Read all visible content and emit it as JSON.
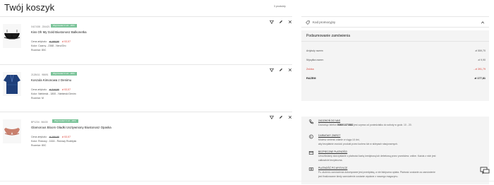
{
  "page": {
    "title": "Twój koszyk",
    "count": "3 produkty"
  },
  "items": [
    {
      "sku": "0417438 . 234421",
      "badge": "Wyprzedaż 3 szt. -30%",
      "name": "Kiss Oh My Gold Biustonosz Balkonetka",
      "price_label": "Cena artykułu:",
      "old_price": "zł 169,99",
      "new_price": "zł 53,57",
      "color": "Kolor: Czarny - 2368 - Nero/Oro",
      "size": "Rozmiar: 80C"
    },
    {
      "sku": "2128411 . 98691",
      "badge": "Wyprzedaż 3 szt. -30%",
      "name": "Koszula Kimonowa z Denimu",
      "price_label": "Cena artykułu:",
      "old_price": "zł 219,99",
      "new_price": "zł 53,57",
      "color": "Kolor: Niebieski - 1800 - Niebieski Denim",
      "size": "Rozmiar: M"
    },
    {
      "sku": "BP1234 . 56430",
      "badge": "Wyprzedaż 3 szt. -30%",
      "name": "Glamorous Bloom Gładki Usztywniony Biustonosz Opaska",
      "price_label": "Cena artykułu:",
      "old_price": "zł 169,99",
      "new_price": "zł 53,57",
      "color": "Kolor: Różowy - 1616 - Różowy Rozbłysk",
      "size": "Rozmiar: 80C"
    }
  ],
  "promo": {
    "label": "Kod promocyjny"
  },
  "summary": {
    "title": "Podsumowanie zamówienia",
    "rows": [
      {
        "label": "Artykuły razem",
        "value": "zł 559,70"
      },
      {
        "label": "Wysyłka razem",
        "value": "zł 9,90"
      },
      {
        "label": "Zniżka",
        "value": "- zł 391,79"
      },
      {
        "label": "RAZEM",
        "value": "zł 177,81"
      }
    ]
  },
  "info": [
    {
      "icon": "phone-icon",
      "heading": "ZADZWOŃ DO NAS",
      "text": "Dzwoniąc telefon ",
      "phone": "008001373882",
      "text2": " jest czynna od poniedziałku do soboty w godz. 10 - 20."
    },
    {
      "icon": "return-icon",
      "heading": "DARMOWY ZWROT",
      "text": "Możesz zmienić zdanie w ciągu 14 dni,",
      "line2": "aby bezpłatnie zwrócić produkt przez kuriera lub w sklepach stacjonarnych."
    },
    {
      "icon": "card-icon",
      "heading": "BEZPIECZNE PŁATNOŚCI",
      "text": "Umożliwiamy skorzystanie z płatności kartą kredytową lub debetową przez przedsiew. online. Każda z nich jest",
      "line2": "całkowicie bezpieczna."
    },
    {
      "icon": "cash-icon",
      "heading": "PŁATNOŚĆ PO WYSYŁCE",
      "text": "Po złożeniu zamówienia dokonywane jest przedpłatą, a nie faktyczna opłata. Płatność zostanie za zamówienie",
      "line2": "jest finalizowane kiedy zamówienie zostanie wysłane z naszego magazynu."
    }
  ]
}
